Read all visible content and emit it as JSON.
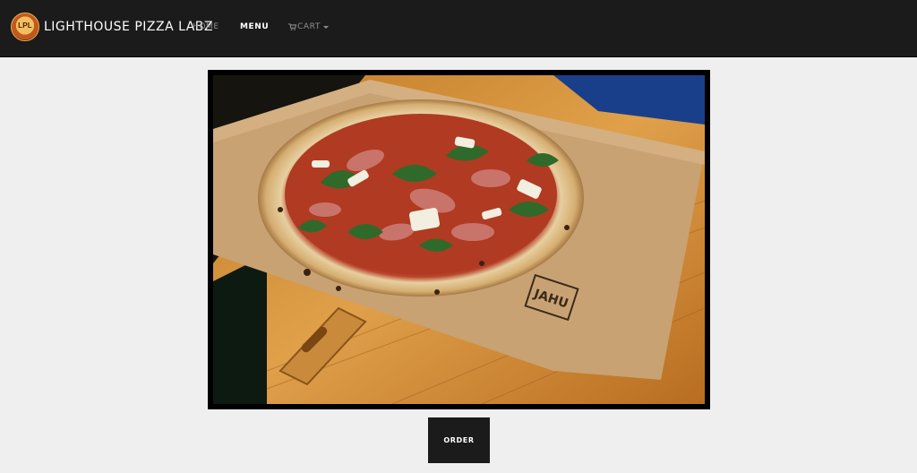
{
  "navbar": {
    "brand": {
      "logo_text": "LPL",
      "name": "LIGHTHOUSE PIZZA LABZ"
    },
    "links": [
      {
        "label": "HOME",
        "active": false
      },
      {
        "label": "MENU",
        "active": true
      },
      {
        "label": "CART",
        "icon": "cart-icon",
        "has_dropdown": true,
        "active": false
      }
    ]
  },
  "hero": {
    "image": "pizza-photo",
    "stamp_text": "JAHU"
  },
  "order_button": {
    "label": "ORDER"
  },
  "colors": {
    "navbar_bg": "#1b1b1b",
    "page_bg": "#efefef",
    "button_bg": "#1b1b1b"
  }
}
